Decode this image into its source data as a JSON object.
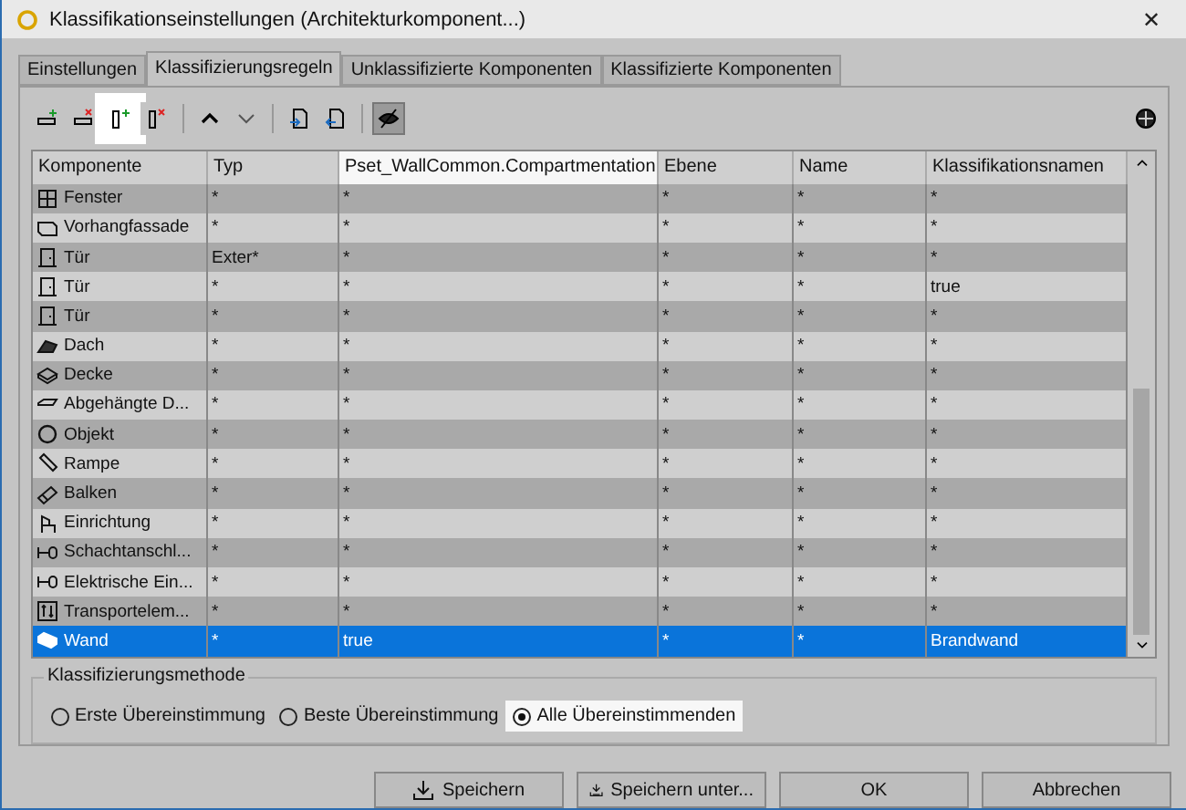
{
  "window": {
    "title": "Klassifikationseinstellungen (Architekturkomponent...)",
    "close": "✕"
  },
  "tabs": [
    {
      "label": "Einstellungen",
      "selected": false
    },
    {
      "label": "Klassifizierungsregeln",
      "selected": true
    },
    {
      "label": "Unklassifizierte Komponenten",
      "selected": false
    },
    {
      "label": "Klassifizierte Komponenten",
      "selected": false
    }
  ],
  "toolbar": [
    {
      "kind": "add-row",
      "highlighted": false,
      "pressed": false
    },
    {
      "kind": "remove-row",
      "highlighted": false,
      "pressed": false
    },
    {
      "kind": "add-column",
      "highlighted": true,
      "pressed": false
    },
    {
      "kind": "remove-column",
      "highlighted": false,
      "pressed": false
    },
    {
      "kind": "up",
      "highlighted": false,
      "pressed": false,
      "group_start": true
    },
    {
      "kind": "down",
      "highlighted": false,
      "pressed": false
    },
    {
      "kind": "import",
      "highlighted": false,
      "pressed": false,
      "group_start": true
    },
    {
      "kind": "export",
      "highlighted": false,
      "pressed": false
    },
    {
      "kind": "hide",
      "highlighted": false,
      "pressed": true,
      "group_start": true
    }
  ],
  "table": {
    "columns": [
      {
        "label": "Komponente",
        "highlighted": false
      },
      {
        "label": "Typ",
        "highlighted": false
      },
      {
        "label": "Pset_WallCommon.Compartmentation",
        "highlighted": true
      },
      {
        "label": "Ebene",
        "highlighted": false
      },
      {
        "label": "Name",
        "highlighted": false
      },
      {
        "label": "Klassifikationsnamen",
        "highlighted": false
      }
    ],
    "rows": [
      {
        "kind": "window",
        "selected": false,
        "cells": [
          "Fenster",
          "*",
          "*",
          "*",
          "*",
          "*"
        ]
      },
      {
        "kind": "curtain-wall",
        "selected": false,
        "cells": [
          "Vorhangfassade",
          "*",
          "*",
          "*",
          "*",
          "*"
        ]
      },
      {
        "kind": "door",
        "selected": false,
        "cells": [
          "Tür",
          "Exter*",
          "*",
          "*",
          "*",
          "*"
        ]
      },
      {
        "kind": "door",
        "selected": false,
        "cells": [
          "Tür",
          "*",
          "*",
          "*",
          "*",
          "true"
        ]
      },
      {
        "kind": "door",
        "selected": false,
        "cells": [
          "Tür",
          "*",
          "*",
          "*",
          "*",
          "*"
        ]
      },
      {
        "kind": "roof",
        "selected": false,
        "cells": [
          "Dach",
          "*",
          "*",
          "*",
          "*",
          "*"
        ]
      },
      {
        "kind": "ceiling",
        "selected": false,
        "cells": [
          "Decke",
          "*",
          "*",
          "*",
          "*",
          "*"
        ]
      },
      {
        "kind": "suspended-ceiling",
        "selected": false,
        "cells": [
          "Abgehängte D...",
          "*",
          "*",
          "*",
          "*",
          "*"
        ]
      },
      {
        "kind": "object",
        "selected": false,
        "cells": [
          "Objekt",
          "*",
          "*",
          "*",
          "*",
          "*"
        ]
      },
      {
        "kind": "ramp",
        "selected": false,
        "cells": [
          "Rampe",
          "*",
          "*",
          "*",
          "*",
          "*"
        ]
      },
      {
        "kind": "beam",
        "selected": false,
        "cells": [
          "Balken",
          "*",
          "*",
          "*",
          "*",
          "*"
        ]
      },
      {
        "kind": "furniture",
        "selected": false,
        "cells": [
          "Einrichtung",
          "*",
          "*",
          "*",
          "*",
          "*"
        ]
      },
      {
        "kind": "connector",
        "selected": false,
        "cells": [
          "Schachtanschl...",
          "*",
          "*",
          "*",
          "*",
          "*"
        ]
      },
      {
        "kind": "connector",
        "selected": false,
        "cells": [
          "Elektrische Ein...",
          "*",
          "*",
          "*",
          "*",
          "*"
        ]
      },
      {
        "kind": "transport",
        "selected": false,
        "cells": [
          "Transportelem...",
          "*",
          "*",
          "*",
          "*",
          "*"
        ]
      },
      {
        "kind": "wall",
        "selected": true,
        "cells": [
          "Wand",
          "*",
          "true",
          "*",
          "*",
          "Brandwand"
        ]
      }
    ]
  },
  "method": {
    "title": "Klassifizierungsmethode",
    "options": [
      {
        "label": "Erste Übereinstimmung",
        "selected": false,
        "highlighted": false
      },
      {
        "label": "Beste Übereinstimmung",
        "selected": false,
        "highlighted": false
      },
      {
        "label": "Alle Übereinstimmenden",
        "selected": true,
        "highlighted": true
      }
    ]
  },
  "buttons": [
    {
      "label": "Speichern",
      "kind": "save"
    },
    {
      "label": "Speichern unter...",
      "kind": "save-as"
    },
    {
      "label": "OK",
      "kind": "plain"
    },
    {
      "label": "Abbrechen",
      "kind": "plain"
    }
  ]
}
